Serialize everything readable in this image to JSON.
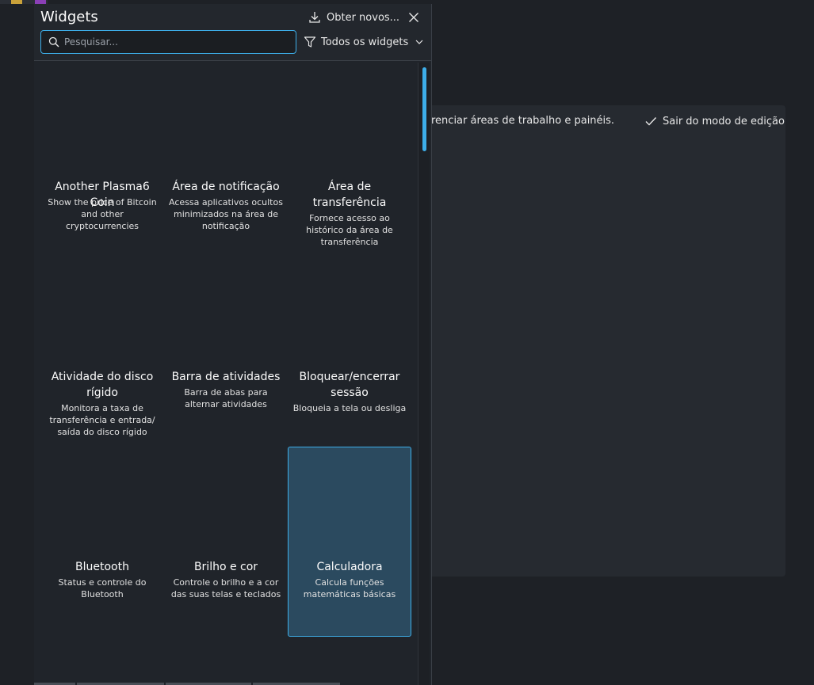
{
  "panel": {
    "title": "Widgets",
    "get_new_label": "Obter novos...",
    "search_placeholder": "Pesquisar...",
    "filter_label": "Todos os widgets"
  },
  "edit_mode": {
    "manage_label": "renciar áreas de trabalho e painéis...",
    "exit_label": "Sair do modo de edição"
  },
  "widgets": [
    {
      "name": "Another Plasma6 Coin",
      "desc": "Show the price of Bitcoin and other cryptocurrencies"
    },
    {
      "name": "Área de notificação",
      "desc": "Acessa aplicativos ocultos minimizados na área de notificação"
    },
    {
      "name": "Área de transferência",
      "desc": "Fornece acesso ao histórico da área de transferência"
    },
    {
      "name": "Atividade do disco rígido",
      "desc": "Monitora a taxa de transferência e entrada/ saída do disco rígido"
    },
    {
      "name": "Barra de atividades",
      "desc": "Barra de abas para alternar atividades"
    },
    {
      "name": "Bloquear/encerrar sessão",
      "desc": "Bloqueia a tela ou desliga"
    },
    {
      "name": "Bluetooth",
      "desc": "Status e controle do Bluetooth"
    },
    {
      "name": "Brilho e cor",
      "desc": "Controle o brilho e a cor das suas telas e teclados"
    },
    {
      "name": "Calculadora",
      "desc": "Calcula funções matemáticas básicas",
      "selected": true
    }
  ],
  "colors": {
    "accent": "#3daee9",
    "selected_bg": "#2b4a5f",
    "panel_bg": "#20242a"
  }
}
